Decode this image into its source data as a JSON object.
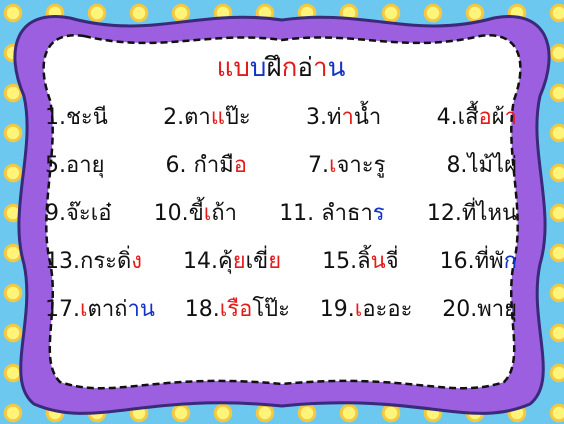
{
  "title": {
    "segments": [
      {
        "text": "แบ",
        "color": "red"
      },
      {
        "text": "บ",
        "color": "blue"
      },
      {
        "text": "ฝึ",
        "color": "black"
      },
      {
        "text": "ก",
        "color": "red"
      },
      {
        "text": "อ่",
        "color": "black"
      },
      {
        "text": "า",
        "color": "red"
      },
      {
        "text": "น",
        "color": "blue"
      }
    ]
  },
  "rows": [
    [
      {
        "num": "1.",
        "segments": [
          {
            "text": "ชะ",
            "color": "black"
          },
          {
            "text": "นี",
            "color": "black"
          }
        ]
      },
      {
        "num": "2.",
        "segments": [
          {
            "text": "ตา",
            "color": "black"
          },
          {
            "text": "แ",
            "color": "red"
          },
          {
            "text": "ป๊ะ",
            "color": "black"
          }
        ]
      },
      {
        "num": "3.",
        "segments": [
          {
            "text": "ท่",
            "color": "black"
          },
          {
            "text": "า",
            "color": "red"
          },
          {
            "text": "น้ำ",
            "color": "black"
          }
        ]
      },
      {
        "num": "4.",
        "segments": [
          {
            "text": "เสื้",
            "color": "black"
          },
          {
            "text": "อ",
            "color": "red"
          },
          {
            "text": "ผ้",
            "color": "black"
          },
          {
            "text": "า",
            "color": "red"
          }
        ]
      }
    ],
    [
      {
        "num": "5.",
        "segments": [
          {
            "text": "อา",
            "color": "black"
          },
          {
            "text": "ยุ",
            "color": "black"
          }
        ]
      },
      {
        "num": "6. ",
        "segments": [
          {
            "text": "กำ",
            "color": "black"
          },
          {
            "text": "มื",
            "color": "black"
          },
          {
            "text": "อ",
            "color": "red"
          }
        ]
      },
      {
        "num": "7.",
        "segments": [
          {
            "text": "เ",
            "color": "red"
          },
          {
            "text": "จาะ",
            "color": "black"
          },
          {
            "text": "รู",
            "color": "black"
          }
        ]
      },
      {
        "num": "8.",
        "segments": [
          {
            "text": "ไม้",
            "color": "black"
          },
          {
            "text": "ไผ่",
            "color": "black"
          }
        ]
      }
    ],
    [
      {
        "num": "9.",
        "segments": [
          {
            "text": "จ๊ะ",
            "color": "black"
          },
          {
            "text": "เอ๋",
            "color": "black"
          }
        ]
      },
      {
        "num": "10.",
        "segments": [
          {
            "text": "ขี้",
            "color": "black"
          },
          {
            "text": "เ",
            "color": "red"
          },
          {
            "text": "ถ้า",
            "color": "black"
          }
        ]
      },
      {
        "num": "11. ",
        "segments": [
          {
            "text": "ลำ",
            "color": "black"
          },
          {
            "text": "ธา",
            "color": "black"
          },
          {
            "text": "ร",
            "color": "blue"
          }
        ]
      },
      {
        "num": "12.",
        "segments": [
          {
            "text": "ที่",
            "color": "black"
          },
          {
            "text": "ไหน",
            "color": "black"
          }
        ]
      }
    ],
    [
      {
        "num": "13.",
        "segments": [
          {
            "text": "กระ",
            "color": "black"
          },
          {
            "text": "ดิ่",
            "color": "black"
          },
          {
            "text": "ง",
            "color": "red"
          }
        ]
      },
      {
        "num": "14.",
        "segments": [
          {
            "text": "คุ้",
            "color": "black"
          },
          {
            "text": "ย",
            "color": "red"
          },
          {
            "text": "เขี่",
            "color": "black"
          },
          {
            "text": "ย",
            "color": "red"
          }
        ]
      },
      {
        "num": "15.",
        "segments": [
          {
            "text": "ลิ้",
            "color": "black"
          },
          {
            "text": "น",
            "color": "red"
          },
          {
            "text": "จี่",
            "color": "black"
          }
        ]
      },
      {
        "num": "16.",
        "segments": [
          {
            "text": "ที่",
            "color": "black"
          },
          {
            "text": "พั",
            "color": "black"
          },
          {
            "text": "ก",
            "color": "blue"
          }
        ]
      }
    ],
    [
      {
        "num": "17.",
        "segments": [
          {
            "text": "เ",
            "color": "red"
          },
          {
            "text": "ตา",
            "color": "black"
          },
          {
            "text": "ถ่",
            "color": "black"
          },
          {
            "text": "าน",
            "color": "blue"
          }
        ]
      },
      {
        "num": "18.",
        "segments": [
          {
            "text": "เรือ",
            "color": "red"
          },
          {
            "text": "โป๊ะ",
            "color": "black"
          }
        ]
      },
      {
        "num": "19.",
        "segments": [
          {
            "text": "เ",
            "color": "red"
          },
          {
            "text": "อะอะ",
            "color": "black"
          }
        ]
      },
      {
        "num": "20.",
        "segments": [
          {
            "text": "พา",
            "color": "black"
          },
          {
            "text": "ยุ",
            "color": "black"
          }
        ]
      }
    ]
  ],
  "colors": {
    "background": "#6cc8ef",
    "frame": "#9b5fe0",
    "frame_outline": "#3a2a7a",
    "red": "#e21b1b",
    "blue": "#1431c8",
    "black": "#111111",
    "green": "#19a319"
  }
}
